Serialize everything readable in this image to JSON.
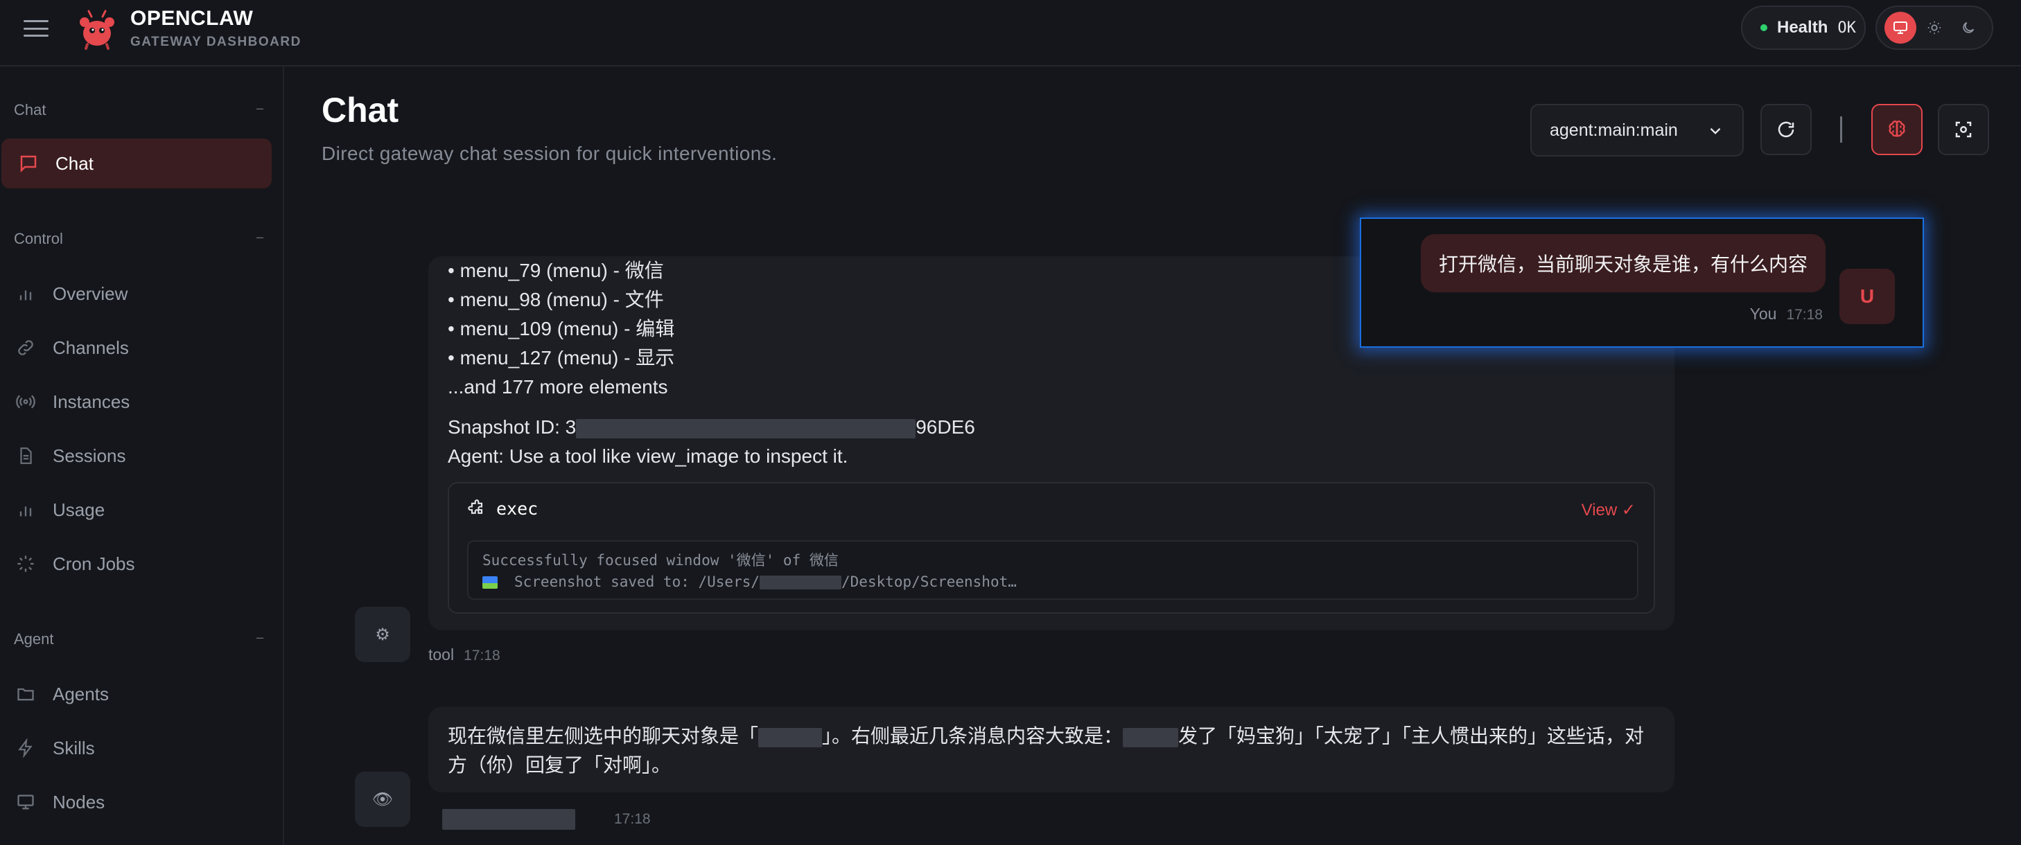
{
  "brand": {
    "title": "OPENCLAW",
    "subtitle": "GATEWAY DASHBOARD"
  },
  "health": {
    "label": "Health",
    "status": "OK",
    "status_color": "#2fd06e"
  },
  "theme": {
    "options": [
      "system",
      "light",
      "dark"
    ],
    "active": "system"
  },
  "sidebar": {
    "sections": [
      {
        "title": "Chat",
        "collapse": "–",
        "items": [
          {
            "label": "Chat",
            "icon": "message-square-icon",
            "active": true
          }
        ]
      },
      {
        "title": "Control",
        "collapse": "–",
        "items": [
          {
            "label": "Overview",
            "icon": "bar-chart-icon"
          },
          {
            "label": "Channels",
            "icon": "link-icon"
          },
          {
            "label": "Instances",
            "icon": "radio-icon"
          },
          {
            "label": "Sessions",
            "icon": "file-text-icon"
          },
          {
            "label": "Usage",
            "icon": "bar-chart-icon"
          },
          {
            "label": "Cron Jobs",
            "icon": "loader-icon"
          }
        ]
      },
      {
        "title": "Agent",
        "collapse": "–",
        "items": [
          {
            "label": "Agents",
            "icon": "folder-icon"
          },
          {
            "label": "Skills",
            "icon": "zap-icon"
          },
          {
            "label": "Nodes",
            "icon": "monitor-icon"
          }
        ]
      }
    ]
  },
  "page": {
    "title": "Chat",
    "subtitle": "Direct gateway chat session for quick interventions.",
    "agent_select": "agent:main:main"
  },
  "chat": {
    "tool_message": {
      "lines": [
        "• menu_79 (menu) - 微信",
        "• menu_98 (menu) - 文件",
        "• menu_109 (menu) - 编辑",
        "• menu_127 (menu) - 显示",
        "...and 177 more elements"
      ],
      "snapshot_prefix": "Snapshot ID: 3",
      "snapshot_suffix": "96DE6",
      "agent_line": "Agent: Use a tool like view_image to inspect it.",
      "tool_name": "exec",
      "view_label": "View ✓",
      "output_line1": "Successfully focused window '微信' of 微信",
      "output_line2_prefix": "Screenshot saved to: /Users/",
      "output_line2_suffix": "/Desktop/Screenshot…",
      "sender": "tool",
      "time": "17:18",
      "avatar_glyph": "⚙"
    },
    "assistant_message": {
      "text_part1": "现在微信里左侧选中的聊天对象是「",
      "text_part2": "」。右侧最近几条消息内容大致是：",
      "text_part3": "发了「妈宝狗」「太宠了」「主人惯出来的」这些话，对",
      "text_part4": "方（你）回复了「对啊」。",
      "time": "17:18",
      "avatar_glyph": "👁"
    },
    "user_message": {
      "text": "打开微信，当前聊天对象是谁，有什么内容",
      "sender": "You",
      "time": "17:18",
      "avatar_letter": "U"
    }
  },
  "colors": {
    "accent": "#e5484d",
    "background": "#14161b",
    "card": "#1c1e24",
    "highlight": "#1a6fe0"
  }
}
